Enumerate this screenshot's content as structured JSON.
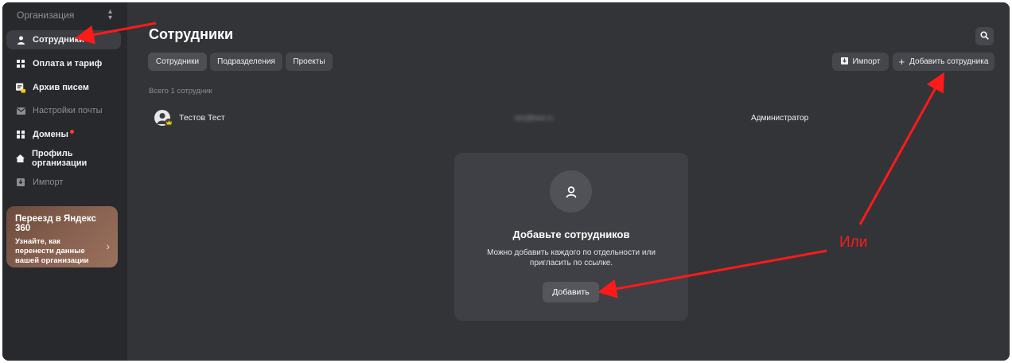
{
  "sidebar": {
    "org_label": "Организация",
    "items": [
      {
        "label": "Сотрудники",
        "icon": "person-icon",
        "active": true
      },
      {
        "label": "Оплата и тариф",
        "icon": "grid-icon"
      },
      {
        "label": "Архив писем",
        "icon": "archive-lock-icon"
      },
      {
        "label": "Настройки почты",
        "icon": "mail-icon",
        "dim": true
      },
      {
        "label": "Домены",
        "icon": "domains-icon",
        "badge": "red-dot"
      },
      {
        "label": "Профиль организации",
        "icon": "home-icon"
      },
      {
        "label": "Импорт",
        "icon": "import-icon",
        "dim": true
      }
    ],
    "promo": {
      "title": "Переезд в Яндекс 360",
      "body": "Узнайте, как перенести данные вашей организации"
    }
  },
  "header": {
    "title": "Сотрудники",
    "tabs": [
      {
        "label": "Сотрудники",
        "active": true
      },
      {
        "label": "Подразделения"
      },
      {
        "label": "Проекты"
      }
    ],
    "import_label": "Импорт",
    "add_employee_label": "Добавить сотрудника"
  },
  "list": {
    "total_label": "Всего 1 сотрудник",
    "rows": [
      {
        "name": "Тестов Тест",
        "email": "test@test.ru",
        "role": "Администратор"
      }
    ]
  },
  "empty_state": {
    "title": "Добавьте сотрудников",
    "subtitle": "Можно добавить каждого по отдельности или пригласить по ссылке.",
    "button": "Добавить"
  },
  "annotation": {
    "text": "Или",
    "color": "#ff1a1a"
  },
  "colors": {
    "background": "#323438",
    "sidebar": "#27292d",
    "card": "#3e4045",
    "button": "#45474c"
  }
}
